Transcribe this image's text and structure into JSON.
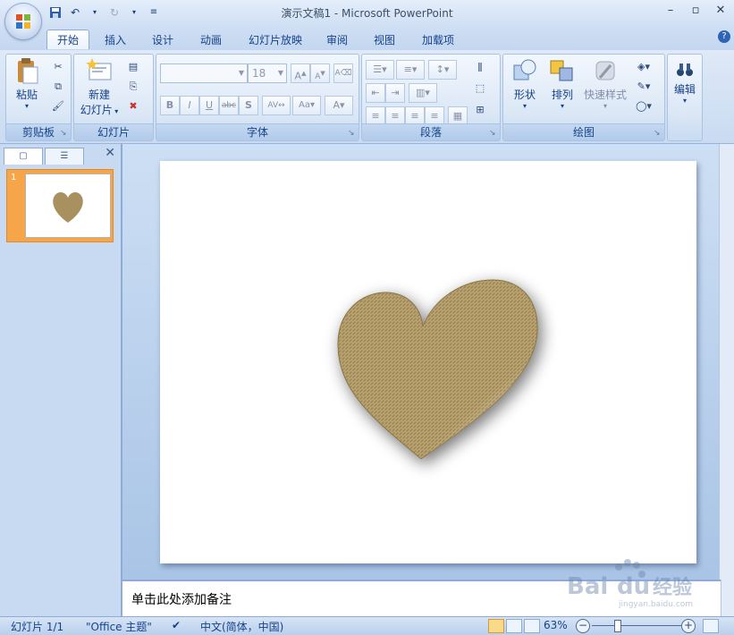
{
  "window": {
    "title": "演示文稿1 - Microsoft PowerPoint"
  },
  "tabs": [
    {
      "label": "开始",
      "active": true
    },
    {
      "label": "插入"
    },
    {
      "label": "设计"
    },
    {
      "label": "动画"
    },
    {
      "label": "幻灯片放映"
    },
    {
      "label": "审阅"
    },
    {
      "label": "视图"
    },
    {
      "label": "加载项"
    }
  ],
  "ribbon": {
    "clipboard": {
      "paste_label": "粘贴",
      "group_label": "剪贴板"
    },
    "slides": {
      "new_slide_label_1": "新建",
      "new_slide_label_2": "幻灯片",
      "group_label": "幻灯片"
    },
    "font": {
      "font_name": "",
      "font_size": "18",
      "group_label": "字体"
    },
    "paragraph": {
      "group_label": "段落"
    },
    "drawing": {
      "shapes_label": "形状",
      "arrange_label": "排列",
      "quick_styles_label": "快速样式",
      "group_label": "绘图"
    },
    "editing": {
      "label": "编辑"
    }
  },
  "slide_panel": {
    "slide_number": "1"
  },
  "notes": {
    "placeholder": "单击此处添加备注"
  },
  "statusbar": {
    "slide_info": "幻灯片 1/1",
    "theme": "\"Office 主题\"",
    "language": "中文(简体，中国)",
    "zoom": "63%"
  },
  "watermark": {
    "text": "Bai du 经验",
    "sub": "jingyan.baidu.com"
  },
  "colors": {
    "heart": "#a8915f",
    "slide_thumb_highlight": "#f6a548",
    "ribbon_text": "#15428b"
  }
}
